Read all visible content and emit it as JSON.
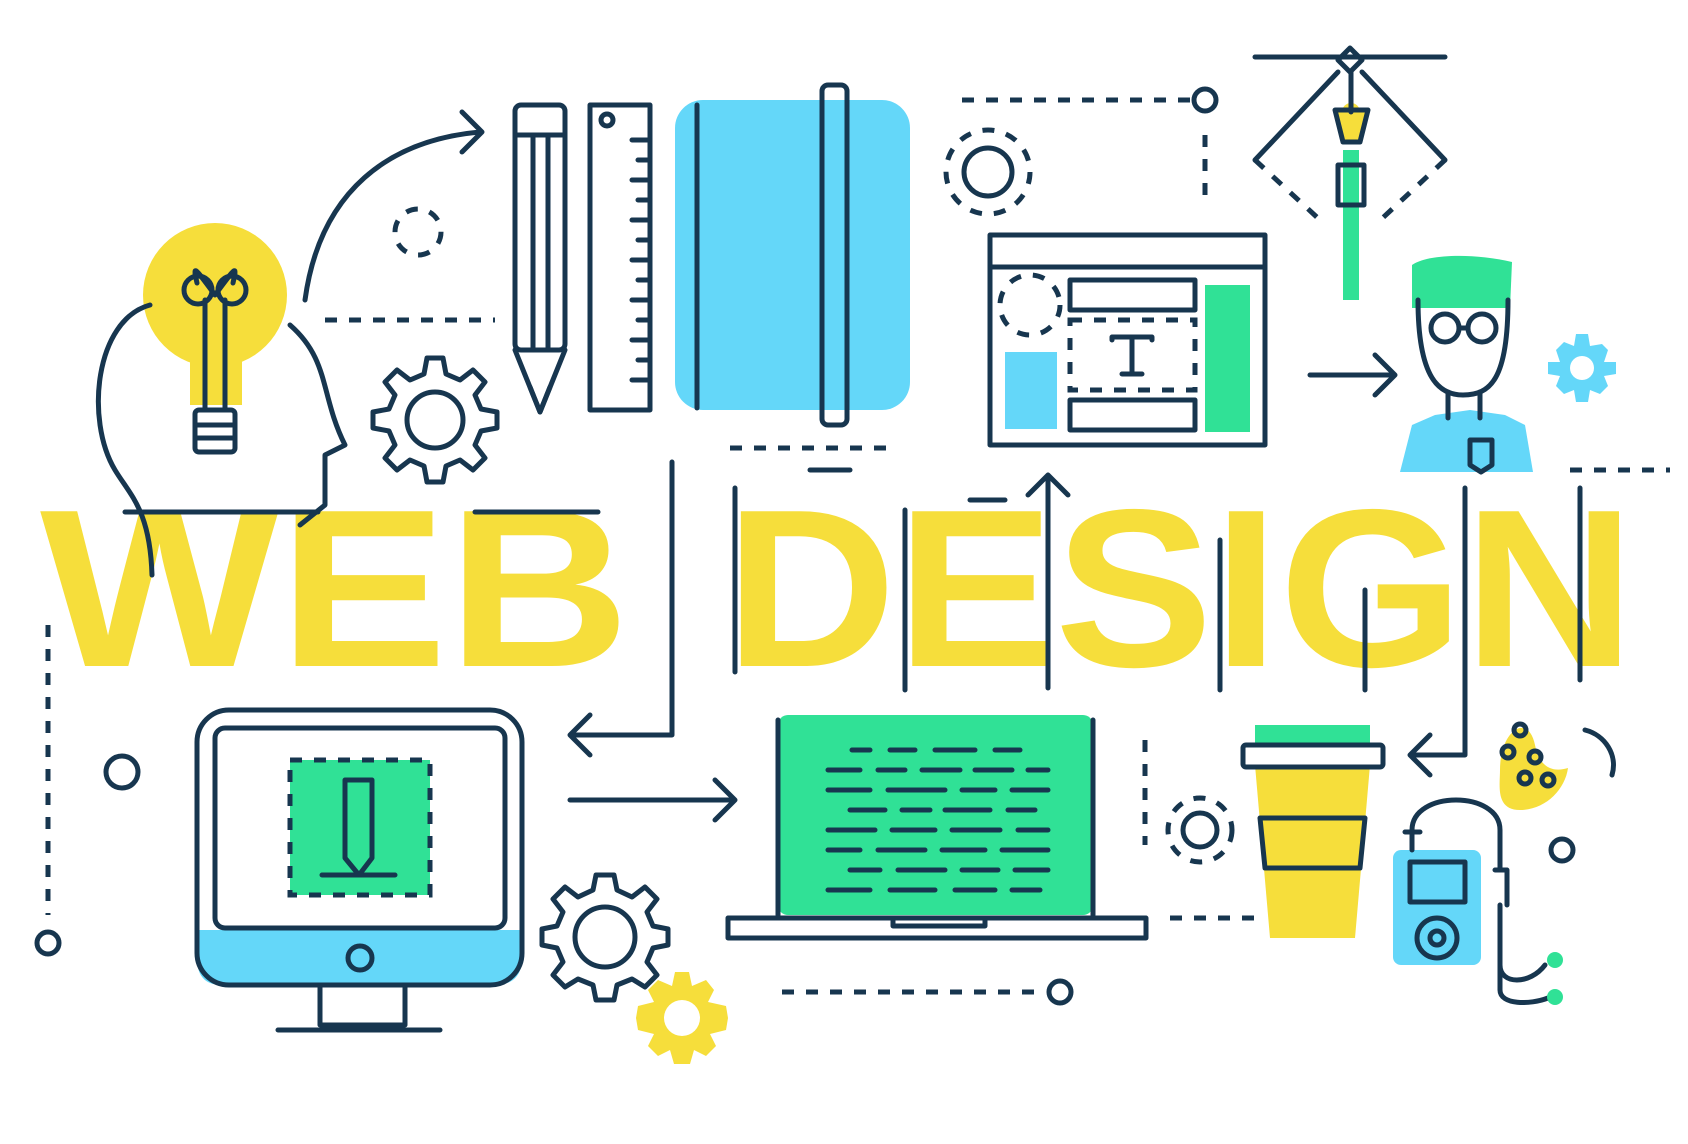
{
  "title": {
    "word1": "WEB",
    "word2": "DESIGN"
  },
  "icons": [
    "lightbulb-icon",
    "head-icon",
    "pencil-icon",
    "ruler-icon",
    "notebook-icon",
    "gear-icon",
    "browser-layout-icon",
    "text-tool-icon",
    "pen-tool-icon",
    "designer-avatar-icon",
    "monitor-icon",
    "laptop-icon",
    "coffee-cup-icon",
    "music-player-icon",
    "cookie-icon",
    "arrow-icon"
  ],
  "colors": {
    "yellow": "#f6de3b",
    "blue": "#64d7f9",
    "green": "#30e196",
    "navy": "#17364f",
    "white": "#ffffff"
  }
}
